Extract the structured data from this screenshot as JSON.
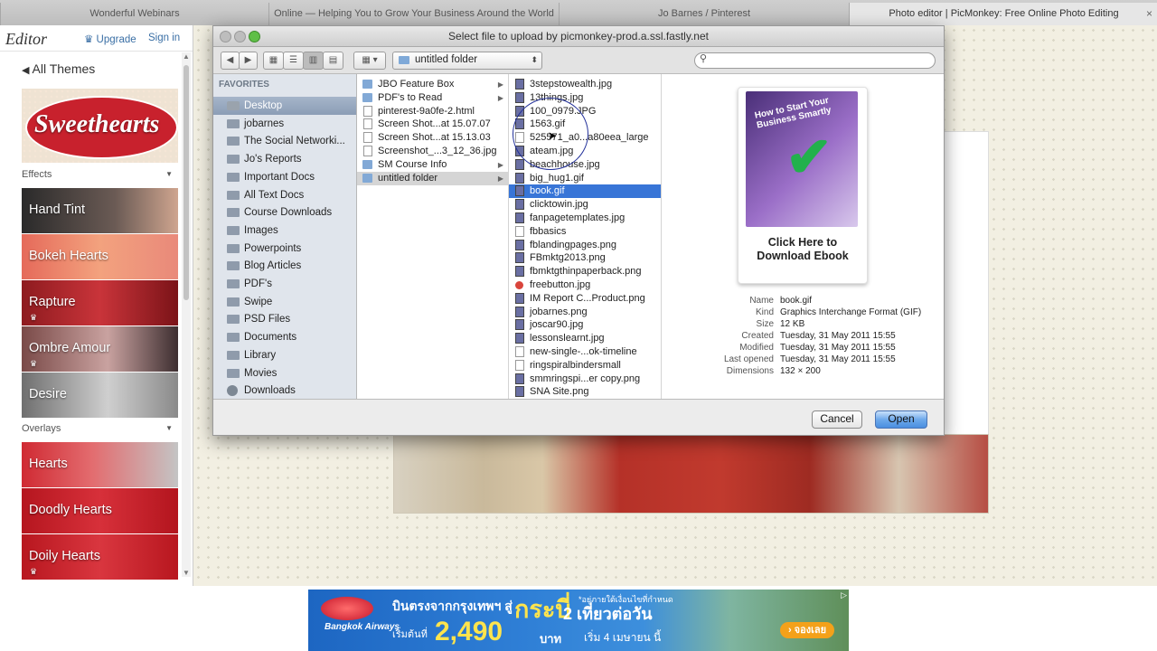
{
  "browser_tabs": [
    {
      "title": "Wonderful Webinars"
    },
    {
      "title": "Online — Helping You to Grow Your Business Around the World"
    },
    {
      "title": "Jo Barnes / Pinterest"
    },
    {
      "title": "Photo editor | PicMonkey: Free Online Photo Editing",
      "active": true
    }
  ],
  "picmonkey": {
    "logo": "Editor",
    "upgrade": "Upgrade",
    "signin": "Sign in",
    "back_label": "All Themes",
    "banner": "Sweethearts",
    "sections": {
      "effects": "Effects",
      "overlays": "Overlays"
    },
    "effects": [
      "Hand Tint",
      "Bokeh Hearts",
      "Rapture",
      "Ombre Amour",
      "Desire"
    ],
    "overlays": [
      "Hearts",
      "Doodly Hearts",
      "Doily Hearts"
    ]
  },
  "dialog": {
    "title": "Select file to upload by picmonkey-prod.a.ssl.fastly.net",
    "current_folder": "untitled folder",
    "search_placeholder": "",
    "favorites_header": "FAVORITES",
    "favorites": [
      "Desktop",
      "jobarnes",
      "The Social Networki...",
      "Jo's Reports",
      "Important Docs",
      "All Text Docs",
      "Course Downloads",
      "Images",
      "Powerpoints",
      "Blog Articles",
      "PDF's",
      "Swipe",
      "PSD Files",
      "Documents",
      "Library",
      "Movies",
      "Downloads"
    ],
    "col1": [
      {
        "name": "JBO Feature Box",
        "type": "folder"
      },
      {
        "name": "PDF's to Read",
        "type": "folder"
      },
      {
        "name": "pinterest-9a0fe-2.html",
        "type": "file"
      },
      {
        "name": "Screen Shot...at 15.07.07",
        "type": "file"
      },
      {
        "name": "Screen Shot...at 15.13.03",
        "type": "file"
      },
      {
        "name": "Screenshot_...3_12_36.jpg",
        "type": "file"
      },
      {
        "name": "SM Course Info",
        "type": "folder"
      },
      {
        "name": "untitled folder",
        "type": "folder"
      }
    ],
    "col2": [
      "3stepstowealth.jpg",
      "13things.jpg",
      "100_0979.JPG",
      "1563.gif",
      "525571_a0...a80eea_large",
      "ateam.jpg",
      "beachhouse.jpg",
      "big_hug1.gif",
      "book.gif",
      "clicktowin.jpg",
      "fanpagetemplates.jpg",
      "fbbasics",
      "fblandingpages.png",
      "FBmktg2013.png",
      "fbmktgthinpaperback.png",
      "freebutton.jpg",
      "IM Report C...Product.png",
      "jobarnes.png",
      "joscar90.jpg",
      "lessonslearnt.jpg",
      "new-single-...ok-timeline",
      "ringspiralbindersmall",
      "smmringspi...er copy.png",
      "SNA Site.png"
    ],
    "preview": {
      "cover_title": "How to Start Your Business Smartly",
      "cta_line1": "Click Here to",
      "cta_line2": "Download Ebook",
      "meta": [
        {
          "k": "Name",
          "v": "book.gif"
        },
        {
          "k": "Kind",
          "v": "Graphics Interchange Format (GIF)"
        },
        {
          "k": "Size",
          "v": "12 KB"
        },
        {
          "k": "Created",
          "v": "Tuesday, 31 May 2011 15:55"
        },
        {
          "k": "Modified",
          "v": "Tuesday, 31 May 2011 15:55"
        },
        {
          "k": "Last opened",
          "v": "Tuesday, 31 May 2011 15:55"
        },
        {
          "k": "Dimensions",
          "v": "132 × 200"
        }
      ]
    },
    "cancel": "Cancel",
    "open": "Open"
  },
  "ad": {
    "line1": "บินตรงจากกรุงเทพฯ สู่",
    "destination": "กระบี่",
    "flights": "2 เที่ยวต่อวัน",
    "note": "*อยู่ภายใต้เงื่อนไขที่กำหนด",
    "price_prefix": "เริ่มต้นที่",
    "price": "2,490",
    "unit": "บาท",
    "start": "เริ่ม 4 เมษายน นี้",
    "brand": "Bangkok Airways",
    "book": "› จองเลย"
  }
}
